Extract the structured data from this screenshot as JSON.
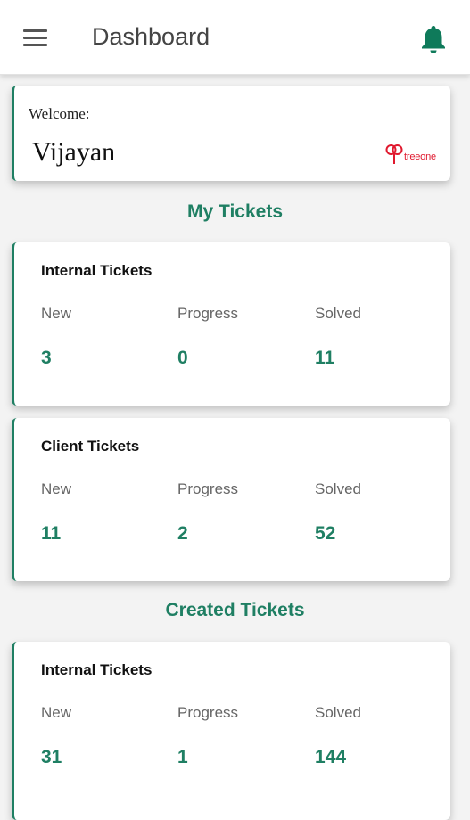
{
  "appbar": {
    "title": "Dashboard"
  },
  "welcome": {
    "label": "Welcome:",
    "name": "Vijayan",
    "logo_text": "treeone"
  },
  "sections": {
    "my_tickets": "My Tickets",
    "created_tickets": "Created Tickets"
  },
  "stat_labels": {
    "new": "New",
    "progress": "Progress",
    "solved": "Solved"
  },
  "my_tickets": {
    "internal": {
      "title": "Internal Tickets",
      "new": "3",
      "progress": "0",
      "solved": "11"
    },
    "client": {
      "title": "Client Tickets",
      "new": "11",
      "progress": "2",
      "solved": "52"
    }
  },
  "created_tickets": {
    "internal": {
      "title": "Internal Tickets",
      "new": "31",
      "progress": "1",
      "solved": "144"
    }
  },
  "icons": {
    "menu": "menu-icon",
    "bell": "bell-icon",
    "logo": "tree-logo-icon"
  },
  "colors": {
    "accent": "#1f7f63",
    "bell": "#0f7a5a",
    "logo": "#e0192e"
  }
}
